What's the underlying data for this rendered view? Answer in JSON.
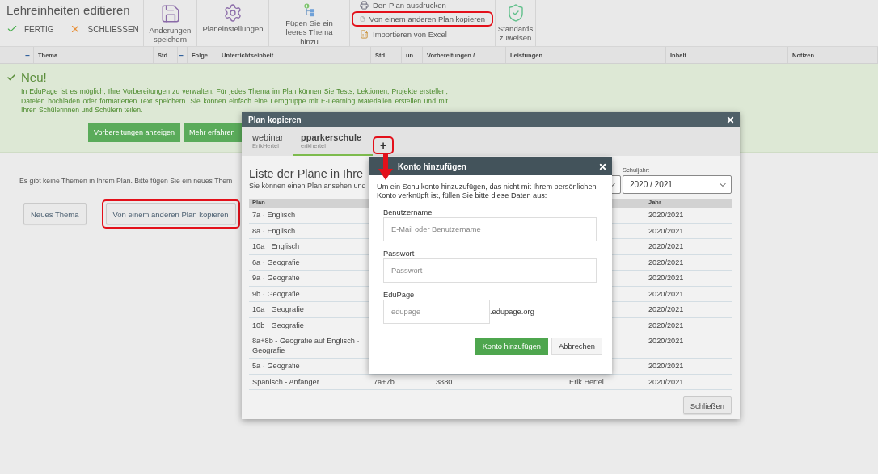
{
  "toolbar": {
    "title": "Lehreinheiten editieren",
    "actions": [
      {
        "label": "FERTIG",
        "kind": "check"
      },
      {
        "label": "SCHLIESSEN",
        "kind": "close"
      }
    ],
    "tools": [
      {
        "label": "Änderungen speichern",
        "kind": "save"
      },
      {
        "label": "Planeinstellungen",
        "kind": "settings"
      },
      {
        "label": "Fügen Sie ein leeres Thema hinzu",
        "kind": "add-topic"
      }
    ],
    "links": [
      {
        "label": "Den Plan ausdrucken",
        "kind": "print",
        "highlighted": false
      },
      {
        "label": "Von einem anderen Plan kopieren",
        "kind": "copy",
        "highlighted": true
      },
      {
        "label": "Importieren von Excel",
        "kind": "excel",
        "highlighted": false
      }
    ],
    "standards": {
      "label": "Standards zuweisen"
    }
  },
  "columns": [
    {
      "label": "−",
      "kind": "toggle"
    },
    {
      "label": "Thema",
      "kind": "text"
    },
    {
      "label": "Std.",
      "kind": "text"
    },
    {
      "label": "−",
      "kind": "toggle"
    },
    {
      "label": "Folge",
      "kind": "text"
    },
    {
      "label": "Unterrichtseinheit",
      "kind": "text"
    },
    {
      "label": "Std.",
      "kind": "text"
    },
    {
      "label": "un…",
      "kind": "text"
    },
    {
      "label": "Vorbereitungen /…",
      "kind": "text"
    },
    {
      "label": "Leistungen",
      "kind": "text"
    },
    {
      "label": "Inhalt",
      "kind": "text"
    },
    {
      "label": "Notizen",
      "kind": "text"
    }
  ],
  "notice": {
    "title": "Neu!",
    "text": "In EduPage ist es möglich, Ihre Vorbereitungen zu verwalten. Für jedes Thema im Plan können Sie Tests, Lektionen, Projekte erstellen, Dateien hochladen oder formatierten Text speichern. Sie können einfach eine Lerngruppe mit E-Learning Materialien erstellen und mit Ihren Schülerinnen und Schülern teilen.",
    "buttons": [
      "Vorbereitungen anzeigen",
      "Mehr erfahren"
    ]
  },
  "empty_state": {
    "message": "Es gibt keine Themen in Ihrem Plan. Bitte fügen Sie ein neues Them",
    "buttons": [
      {
        "label": "Neues Thema",
        "highlighted": false
      },
      {
        "label": "Von einem anderen Plan kopieren",
        "highlighted": true
      }
    ]
  },
  "copy_dialog": {
    "title": "Plan kopieren",
    "tabs": [
      {
        "name": "webinar",
        "user": "ErikHertel",
        "selected": false
      },
      {
        "name": "pparkerschule",
        "user": "erikhertel",
        "selected": true
      }
    ],
    "add_tab": {
      "label": "+",
      "highlighted": true
    },
    "heading": "Liste der Pläne in Ihre",
    "subheading": "Sie können einen Plan ansehen und",
    "year_filter": {
      "label": "Schuljahr:",
      "value": "2020 / 2021"
    },
    "table": {
      "columns": [
        "Plan",
        "Jahr"
      ],
      "rows": [
        {
          "plan": "7a · Englisch",
          "jahr": "2020/2021"
        },
        {
          "plan": "8a · Englisch",
          "jahr": "2020/2021"
        },
        {
          "plan": "10a · Englisch",
          "jahr": "2020/2021"
        },
        {
          "plan": "6a · Geografie",
          "jahr": "2020/2021"
        },
        {
          "plan": "9a · Geografie",
          "jahr": "2020/2021"
        },
        {
          "plan": "9b · Geografie",
          "jahr": "2020/2021"
        },
        {
          "plan": "10a · Geografie",
          "jahr": "2020/2021"
        },
        {
          "plan": "10b · Geografie",
          "jahr": "2020/2021"
        },
        {
          "plan": "8a+8b - Geografie auf Englisch · Geografie",
          "jahr": "2020/2021"
        },
        {
          "plan": "5a · Geografie",
          "jahr": "2020/2021"
        },
        {
          "plan": "Spanisch - Anfänger",
          "column_2": "7a+7b",
          "column_3": "3880",
          "column_4": "Erik Hertel",
          "jahr": "2020/2021"
        }
      ]
    },
    "close_button": "Schließen"
  },
  "add_account_dialog": {
    "title": "Konto hinzufügen",
    "intro": "Um ein Schulkonto hinzuzufügen, das nicht mit Ihrem persönlichen Konto verknüpft ist, füllen Sie bitte diese Daten aus:",
    "fields": [
      {
        "label": "Benutzername",
        "placeholder": "E-Mail oder Benutzername",
        "kind": "wide"
      },
      {
        "label": "Passwort",
        "placeholder": "Passwort",
        "kind": "wide"
      },
      {
        "label": "EduPage",
        "placeholder": "edupage",
        "kind": "domain",
        "suffix": ".edupage.org"
      }
    ],
    "buttons": [
      {
        "label": "Konto hinzufügen",
        "kind": "primary"
      },
      {
        "label": "Abbrechen",
        "kind": "secondary"
      }
    ]
  }
}
